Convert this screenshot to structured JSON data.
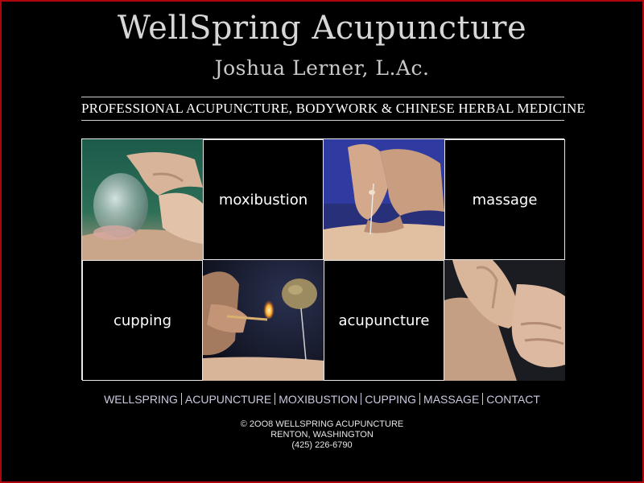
{
  "header": {
    "title": "WellSpring Acupuncture",
    "subtitle": "Joshua Lerner, L.Ac.",
    "tagline": "PROFESSIONAL ACUPUNCTURE, BODYWORK & CHINESE HERBAL MEDICINE"
  },
  "grid": {
    "tiles": [
      {
        "kind": "photo",
        "icon": "glass-cup-on-skin-photo"
      },
      {
        "kind": "text",
        "label": "moxibustion"
      },
      {
        "kind": "photo",
        "icon": "needle-insertion-photo"
      },
      {
        "kind": "text",
        "label": "massage"
      },
      {
        "kind": "text",
        "label": "cupping"
      },
      {
        "kind": "photo",
        "icon": "lighting-moxa-photo"
      },
      {
        "kind": "text",
        "label": "acupuncture"
      },
      {
        "kind": "photo",
        "icon": "hands-massage-photo"
      }
    ]
  },
  "nav": {
    "items": [
      "WELLSPRING",
      "ACUPUNCTURE",
      "MOXIBUSTION",
      "CUPPING",
      "MASSAGE",
      "CONTACT"
    ]
  },
  "footer": {
    "copyright": "© 2OO8 WELLSPRING ACUPUNCTURE",
    "location": "RENTON, WASHINGTON",
    "phone": "(425) 226-6790"
  },
  "colors": {
    "background": "#000000",
    "frame": "#b0060b",
    "title": "#d7d7d7",
    "nav_link": "#c9c9e0"
  }
}
